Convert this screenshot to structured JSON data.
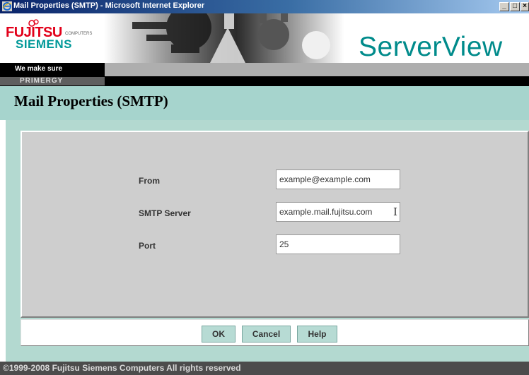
{
  "window": {
    "title": "Mail Properties (SMTP) - Microsoft Internet Explorer",
    "minimize_symbol": "_",
    "maximize_symbol": "□",
    "close_symbol": "×"
  },
  "banner": {
    "logo_top": "FUJITSU",
    "logo_small": "COMPUTERS",
    "logo_bottom": "SIEMENS",
    "product": "ServerView",
    "tagline": "We make sure",
    "section": "PRIMERGY"
  },
  "page": {
    "title": "Mail Properties (SMTP)"
  },
  "form": {
    "from_label": "From",
    "from_value": "example@example.com",
    "smtp_label": "SMTP Server",
    "smtp_value": "example.mail.fujitsu.com",
    "port_label": "Port",
    "port_value": "25"
  },
  "buttons": {
    "ok": "OK",
    "cancel": "Cancel",
    "help": "Help"
  },
  "footer": {
    "copyright": "©1999-2008  Fujitsu Siemens Computers  All rights reserved"
  },
  "colors": {
    "brand_teal": "#008b8b",
    "fujitsu_red": "#e2001a",
    "siemens_teal": "#009999",
    "heading_band": "#a6d4cd",
    "button_bg": "#b7dbd4"
  },
  "icons": {
    "window_icon": "ie-icon",
    "text_cursor": "ibeam-cursor-icon"
  }
}
